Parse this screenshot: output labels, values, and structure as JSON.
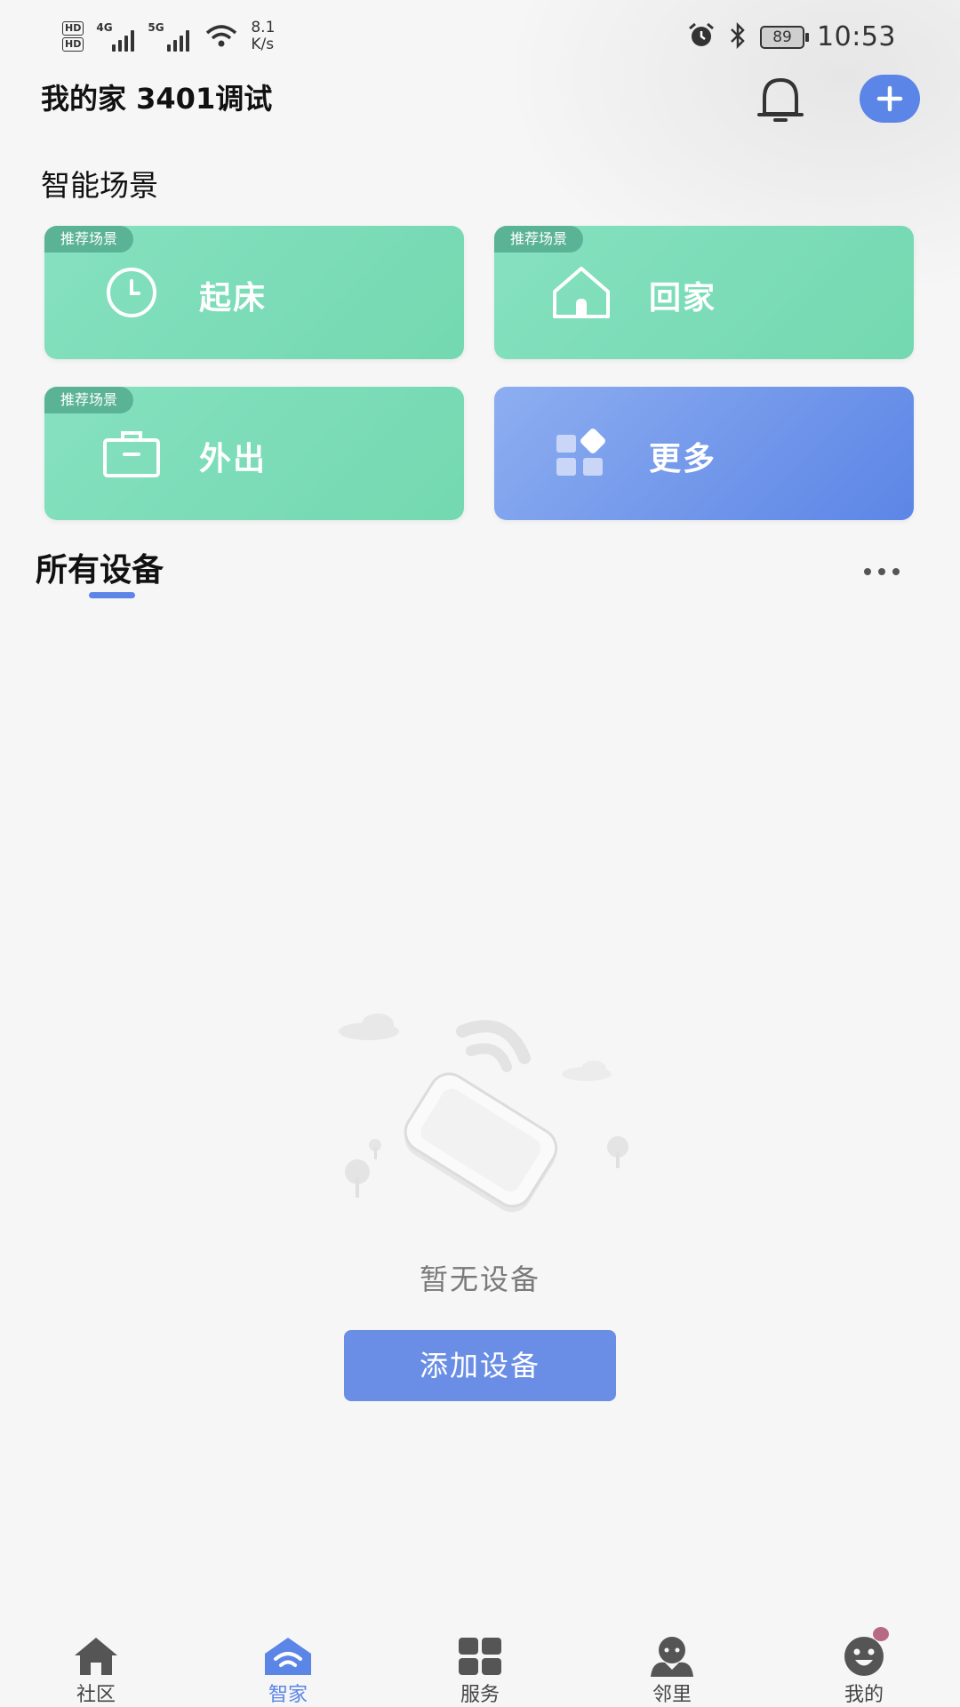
{
  "status_bar": {
    "hd_labels": [
      "HD",
      "HD"
    ],
    "network_1": "4G",
    "network_2": "5G",
    "speed_value": "8.1",
    "speed_unit": "K/s",
    "battery": "89",
    "time": "10:53"
  },
  "header": {
    "title": "我的家 3401调试"
  },
  "scenes": {
    "section_title": "智能场景",
    "cards": [
      {
        "tag": "推荐场景",
        "label": "起床",
        "icon": "clock-icon"
      },
      {
        "tag": "推荐场景",
        "label": "回家",
        "icon": "house-icon"
      },
      {
        "tag": "推荐场景",
        "label": "外出",
        "icon": "briefcase-icon"
      },
      {
        "tag": "",
        "label": "更多",
        "icon": "grid-icon"
      }
    ]
  },
  "devices": {
    "section_title": "所有设备",
    "empty_text": "暂无设备",
    "add_button": "添加设备"
  },
  "bottom_nav": {
    "items": [
      {
        "label": "社区",
        "icon": "house-icon"
      },
      {
        "label": "智家",
        "icon": "smart-home-icon",
        "active": true
      },
      {
        "label": "服务",
        "icon": "grid-icon"
      },
      {
        "label": "邻里",
        "icon": "neighbor-icon"
      },
      {
        "label": "我的",
        "icon": "face-icon",
        "badge": true
      }
    ]
  },
  "colors": {
    "accent": "#5b85e6",
    "scene_green": "#7adcb5",
    "badge": "#b76a86"
  }
}
